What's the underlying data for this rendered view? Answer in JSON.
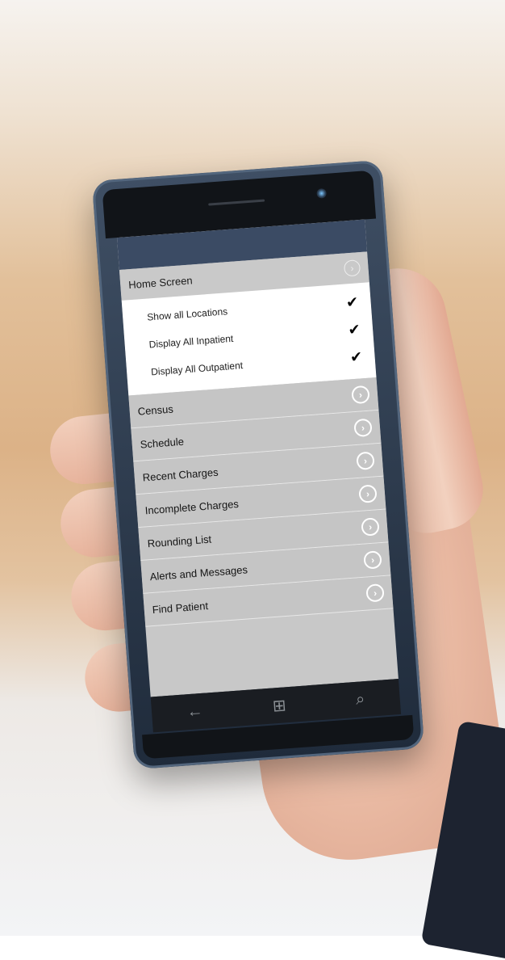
{
  "menu": {
    "section": {
      "title": "Home Screen",
      "items": [
        {
          "label": "Show all Locations",
          "checked": true
        },
        {
          "label": "Display All Inpatient",
          "checked": true
        },
        {
          "label": "Display All Outpatient",
          "checked": true
        }
      ]
    },
    "items": [
      {
        "label": "Census"
      },
      {
        "label": "Schedule"
      },
      {
        "label": "Recent Charges"
      },
      {
        "label": "Incomplete Charges"
      },
      {
        "label": "Rounding List"
      },
      {
        "label": "Alerts and Messages"
      },
      {
        "label": "Find Patient"
      }
    ]
  },
  "navbar": {
    "back": "←",
    "start": "⊞",
    "search": "⌕"
  }
}
